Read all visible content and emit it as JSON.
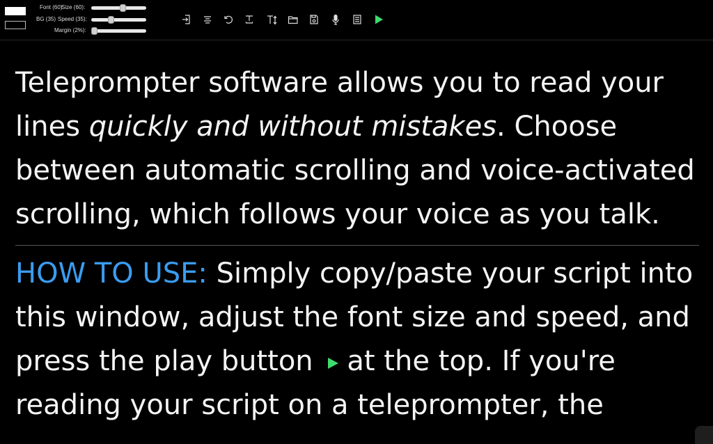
{
  "toolbar": {
    "swatches": {
      "foreground": "#ffffff",
      "background": "#000000"
    },
    "font_label": "Font (60)",
    "size_label": "Size (60):",
    "bg_label": "BG (35)",
    "speed_label": "Speed (35):",
    "margin_label": "Margin (2%):",
    "sliders": {
      "size_level": 0.6,
      "speed_level": 0.35,
      "margin_level": 0.02
    },
    "icons": [
      "import-icon",
      "align-icon",
      "undo-icon",
      "text-format-icon",
      "text-size-icon",
      "open-folder-icon",
      "save-icon",
      "microphone-icon",
      "document-icon",
      "play-icon"
    ]
  },
  "script": {
    "para1_a": "Teleprompter software allows you to read your lines ",
    "para1_em": "quickly and without mistakes",
    "para1_b": ". Choose between automatic scrolling and voice-activated scrolling, which follows your voice as you talk.",
    "howto_label": "HOW TO USE:",
    "para2_a": " Simply copy/paste your script into this window, adjust the font size and speed, and press the play button",
    "para2_b": "at the top.   If you're reading your script on a teleprompter, the"
  },
  "colors": {
    "accent": "#3b9cf0",
    "play": "#3ddc6e",
    "text": "#f4f4f4",
    "background": "#000000"
  }
}
